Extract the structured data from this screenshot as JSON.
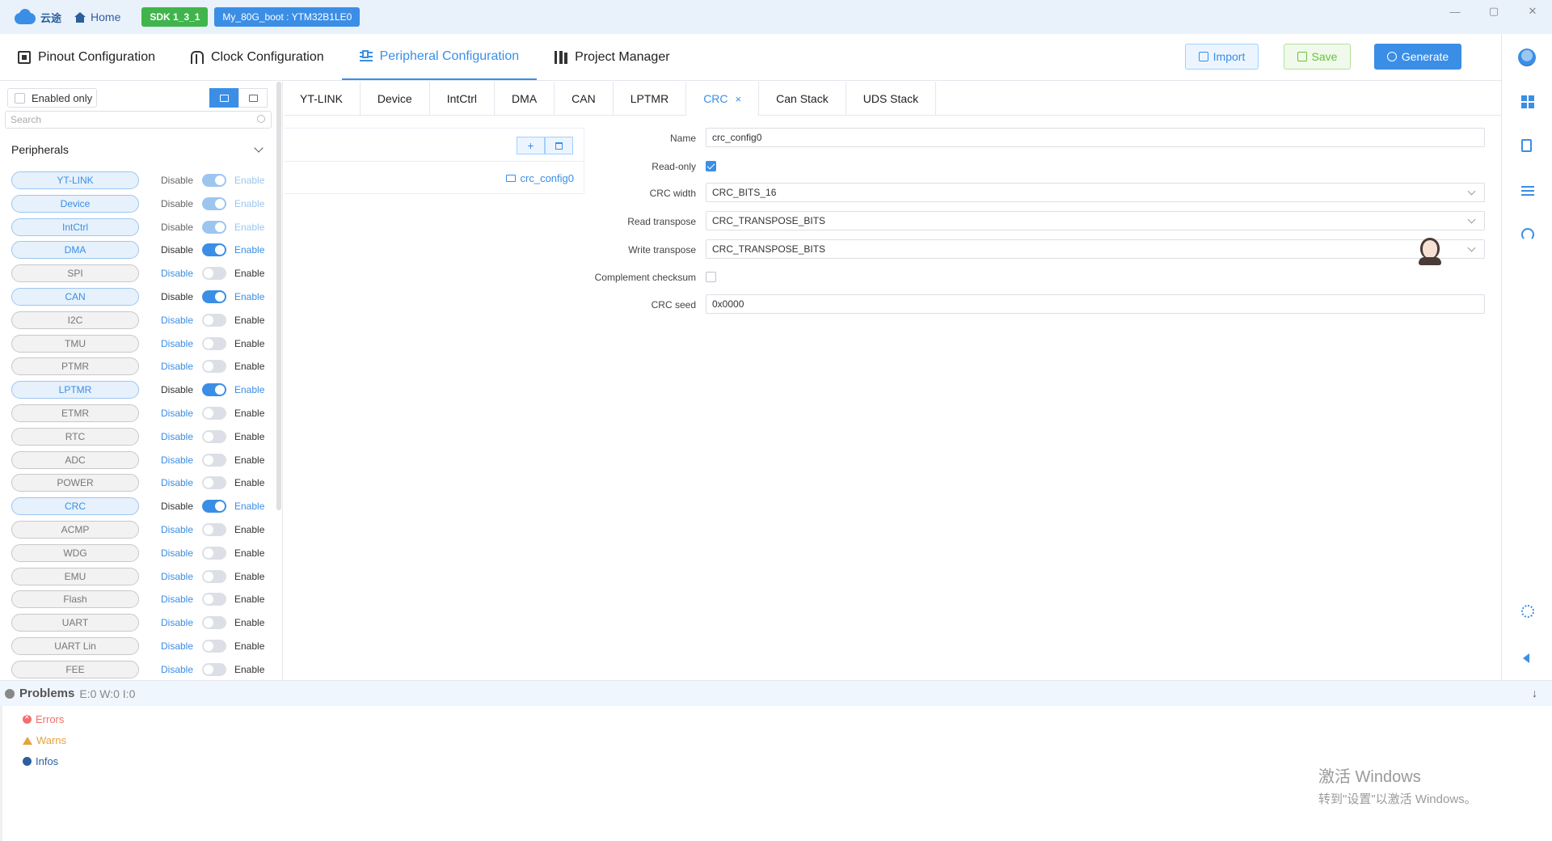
{
  "titlebar": {
    "logo_text": "云途",
    "home_label": "Home",
    "sdk_tag": "SDK 1_3_1",
    "project_tag": "My_80G_boot : YTM32B1LE0",
    "window_controls": [
      "—",
      "▢",
      "✕"
    ]
  },
  "mainnav": {
    "tabs": [
      {
        "label": "Pinout Configuration",
        "icon": "chip-icon"
      },
      {
        "label": "Clock Configuration",
        "icon": "clock-icon"
      },
      {
        "label": "Peripheral Configuration",
        "icon": "peripheral-icon",
        "active": true
      },
      {
        "label": "Project Manager",
        "icon": "project-icon"
      }
    ],
    "import_label": "Import",
    "save_label": "Save",
    "generate_label": "Generate"
  },
  "sidebar": {
    "enabled_only_label": "Enabled only",
    "search_placeholder": "Search",
    "section_title": "Peripherals",
    "disable_label": "Disable",
    "enable_label": "Enable",
    "peripherals": [
      {
        "name": "YT-LINK",
        "state": "locked"
      },
      {
        "name": "Device",
        "state": "locked"
      },
      {
        "name": "IntCtrl",
        "state": "locked"
      },
      {
        "name": "DMA",
        "state": "on"
      },
      {
        "name": "SPI",
        "state": "off"
      },
      {
        "name": "CAN",
        "state": "on"
      },
      {
        "name": "I2C",
        "state": "off"
      },
      {
        "name": "TMU",
        "state": "off"
      },
      {
        "name": "PTMR",
        "state": "off"
      },
      {
        "name": "LPTMR",
        "state": "on"
      },
      {
        "name": "ETMR",
        "state": "off"
      },
      {
        "name": "RTC",
        "state": "off"
      },
      {
        "name": "ADC",
        "state": "off"
      },
      {
        "name": "POWER",
        "state": "off"
      },
      {
        "name": "CRC",
        "state": "on"
      },
      {
        "name": "ACMP",
        "state": "off"
      },
      {
        "name": "WDG",
        "state": "off"
      },
      {
        "name": "EMU",
        "state": "off"
      },
      {
        "name": "Flash",
        "state": "off"
      },
      {
        "name": "UART",
        "state": "off"
      },
      {
        "name": "UART Lin",
        "state": "off"
      },
      {
        "name": "FEE",
        "state": "off"
      }
    ]
  },
  "subtabs": [
    {
      "label": "YT-LINK"
    },
    {
      "label": "Device"
    },
    {
      "label": "IntCtrl"
    },
    {
      "label": "DMA"
    },
    {
      "label": "CAN"
    },
    {
      "label": "LPTMR"
    },
    {
      "label": "CRC",
      "active": true,
      "closable": true
    },
    {
      "label": "Can Stack"
    },
    {
      "label": "UDS Stack"
    }
  ],
  "config_list": {
    "add_symbol": "+",
    "item": "crc_config0"
  },
  "form": {
    "name_label": "Name",
    "name_value": "crc_config0",
    "readonly_label": "Read-only",
    "readonly_checked": true,
    "crc_width_label": "CRC width",
    "crc_width_value": "CRC_BITS_16",
    "read_transpose_label": "Read transpose",
    "read_transpose_value": "CRC_TRANSPOSE_BITS",
    "write_transpose_label": "Write transpose",
    "write_transpose_value": "CRC_TRANSPOSE_BITS",
    "complement_label": "Complement checksum",
    "complement_checked": false,
    "seed_label": "CRC seed",
    "seed_value": "0x0000"
  },
  "problems": {
    "title": "Problems",
    "counts": "E:0 W:0 I:0",
    "errors_label": "Errors",
    "warns_label": "Warns",
    "infos_label": "Infos"
  },
  "watermark": {
    "line1": "激活 Windows",
    "line2": "转到\"设置\"以激活 Windows。"
  },
  "colors": {
    "accent": "#3a8ee6",
    "sdk_tag": "#3fb54b",
    "error": "#f56c6c",
    "warning": "#e6a23c"
  }
}
